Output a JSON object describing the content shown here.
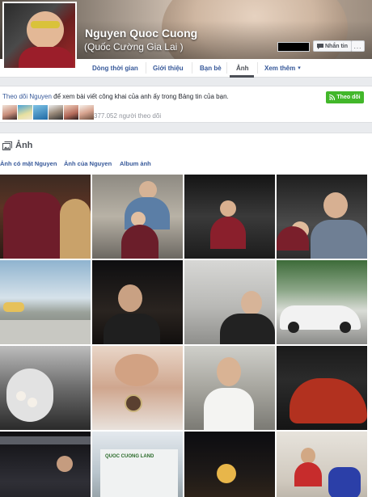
{
  "profile": {
    "name": "Nguyen Quoc Cuong",
    "alternate_name": "(Quốc Cường Gia Lai )"
  },
  "cover_actions": {
    "message_label": "Nhắn tin",
    "more_label": "...",
    "message_icon": "message-icon"
  },
  "nav": {
    "tabs": [
      {
        "label": "Dòng thời gian",
        "active": false
      },
      {
        "label": "Giới thiệu",
        "active": false
      },
      {
        "label": "Bạn bè",
        "active": false
      },
      {
        "label": "Ảnh",
        "active": true
      },
      {
        "label": "Xem thêm",
        "active": false
      }
    ],
    "more_caret": "▾"
  },
  "follow": {
    "text_link": "Theo dõi Nguyen",
    "text_rest": " để xem bài viết công khai của anh ấy trong Bảng tin của bạn.",
    "button_label": "Theo dõi",
    "follower_count": "377.052 người theo dõi",
    "follower_faces": 6
  },
  "photos": {
    "title": "Ảnh",
    "title_icon": "photos-icon",
    "subtabs": [
      "Ảnh có mặt Nguyen",
      "Ảnh của Nguyen",
      "Album ảnh"
    ],
    "sign_text": "QUOC CUONG LAND"
  },
  "colors": {
    "link": "#365899",
    "follow_green": "#42b72a",
    "page_bg": "#e9ebee"
  }
}
